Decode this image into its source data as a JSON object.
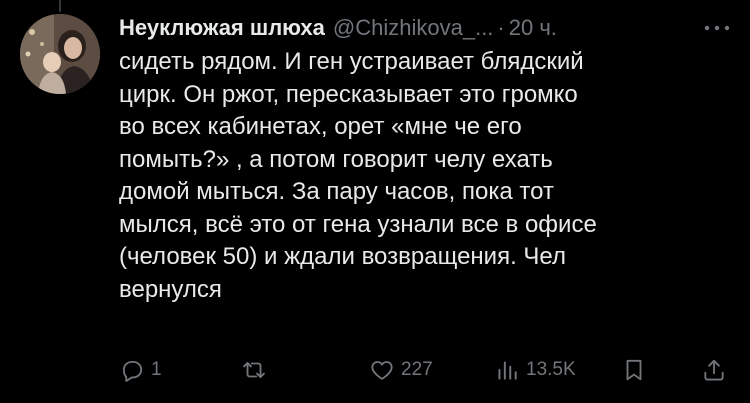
{
  "tweet": {
    "display_name": "Неуклюжая шлюха",
    "handle": "@Chizhikova_...",
    "separator": "·",
    "time": "20 ч.",
    "text": "сидеть рядом. И ген устраивает блядский\nцирк. Он ржот, пересказывает это громко\nво всех кабинетах, орет «мне че его\nпомыть?» , а потом говорит челу ехать\nдомой мыться. За пару часов, пока тот\nмылся, всё это от гена узнали все в офисе\n(человек 50) и ждали возвращения. Чел\nвернулся"
  },
  "actions": {
    "reply_count": "1",
    "retweet_count": "",
    "like_count": "227",
    "views_count": "13.5K"
  },
  "icons": {
    "more": "more-dots-icon",
    "reply": "reply-bubble-icon",
    "retweet": "retweet-icon",
    "like": "heart-icon",
    "views": "views-chart-icon",
    "bookmark": "bookmark-icon",
    "share": "share-icon"
  },
  "colors": {
    "background": "#000000",
    "text_primary": "#e7e9ea",
    "text_secondary": "#71767b",
    "thread_line": "#333639"
  }
}
